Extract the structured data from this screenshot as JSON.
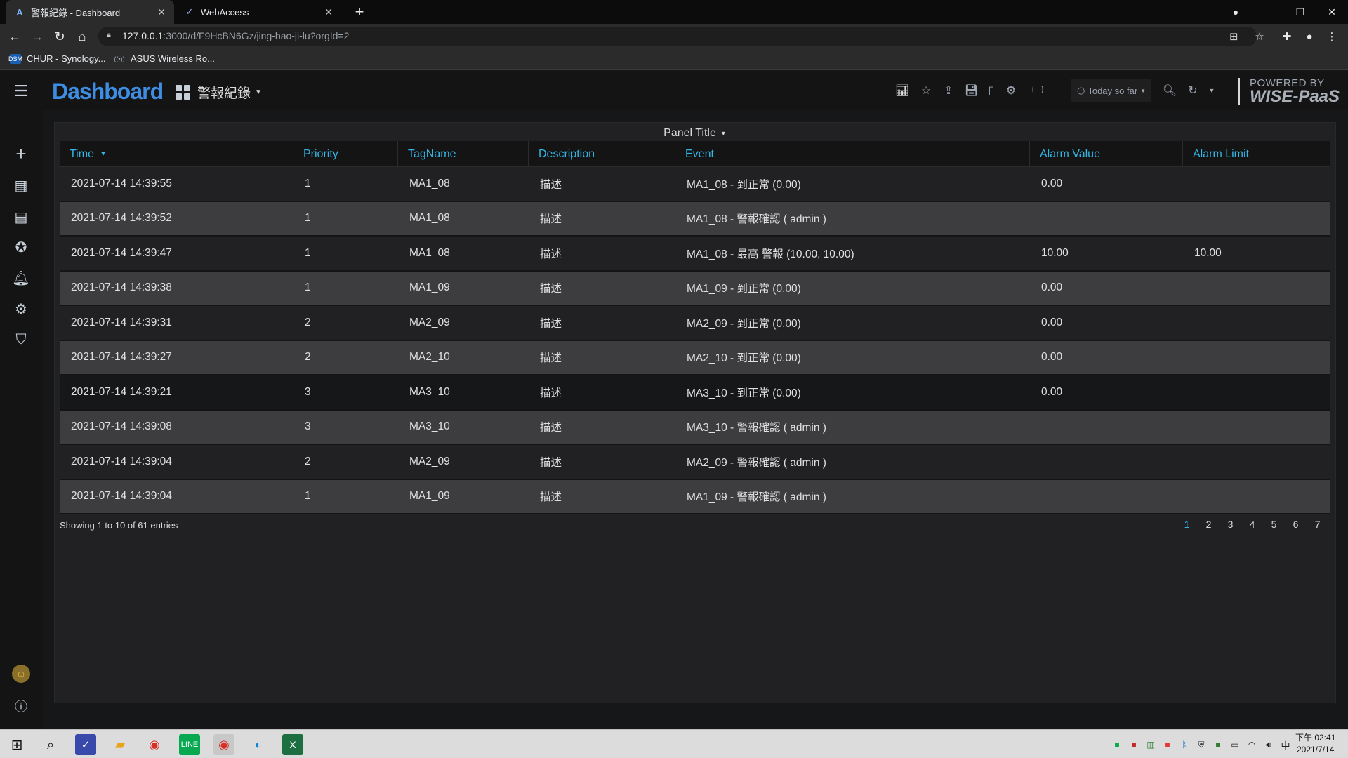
{
  "browser": {
    "tabs": [
      {
        "title": "警報紀錄 - Dashboard",
        "active": true
      },
      {
        "title": "WebAccess",
        "active": false
      }
    ],
    "url_host": "127.0.0.1",
    "url_path": ":3000/d/F9HcBN6Gz/jing-bao-ji-lu?orgId=2",
    "bookmarks": [
      "CHUR - Synology...",
      "ASUS Wireless Ro..."
    ]
  },
  "grafana": {
    "brand": "Dashboard",
    "dashboard_title": "警報紀錄",
    "time_range": "Today so far",
    "powered_line1": "POWERED BY",
    "powered_line2": "WISE-PaaS"
  },
  "panel": {
    "title": "Panel Title",
    "columns": [
      "Time",
      "Priority",
      "TagName",
      "Description",
      "Event",
      "Alarm Value",
      "Alarm Limit"
    ],
    "rows": [
      [
        "2021-07-14 14:39:55",
        "1",
        "MA1_08",
        "描述",
        "MA1_08 - 到正常 (0.00)",
        "0.00",
        ""
      ],
      [
        "2021-07-14 14:39:52",
        "1",
        "MA1_08",
        "描述",
        "MA1_08 - 警報確認 ( admin )",
        "",
        ""
      ],
      [
        "2021-07-14 14:39:47",
        "1",
        "MA1_08",
        "描述",
        "MA1_08 - 最高 警報 (10.00, 10.00)",
        "10.00",
        "10.00"
      ],
      [
        "2021-07-14 14:39:38",
        "1",
        "MA1_09",
        "描述",
        "MA1_09 - 到正常 (0.00)",
        "0.00",
        ""
      ],
      [
        "2021-07-14 14:39:31",
        "2",
        "MA2_09",
        "描述",
        "MA2_09 - 到正常 (0.00)",
        "0.00",
        ""
      ],
      [
        "2021-07-14 14:39:27",
        "2",
        "MA2_10",
        "描述",
        "MA2_10 - 到正常 (0.00)",
        "0.00",
        ""
      ],
      [
        "2021-07-14 14:39:21",
        "3",
        "MA3_10",
        "描述",
        "MA3_10 - 到正常 (0.00)",
        "0.00",
        ""
      ],
      [
        "2021-07-14 14:39:08",
        "3",
        "MA3_10",
        "描述",
        "MA3_10 - 警報確認 ( admin )",
        "",
        ""
      ],
      [
        "2021-07-14 14:39:04",
        "2",
        "MA2_09",
        "描述",
        "MA2_09 - 警報確認 ( admin )",
        "",
        ""
      ],
      [
        "2021-07-14 14:39:04",
        "1",
        "MA1_09",
        "描述",
        "MA1_09 - 警報確認 ( admin )",
        "",
        ""
      ]
    ],
    "entries_info": "Showing 1 to 10 of 61 entries",
    "pages": [
      "1",
      "2",
      "3",
      "4",
      "5",
      "6",
      "7"
    ],
    "current_page": "1"
  },
  "taskbar": {
    "clock_line1": "下午 02:41",
    "clock_line2": "2021/7/14",
    "ime": "中"
  },
  "colors": {
    "accent": "#33b5e5",
    "brand": "#3d8de2"
  }
}
